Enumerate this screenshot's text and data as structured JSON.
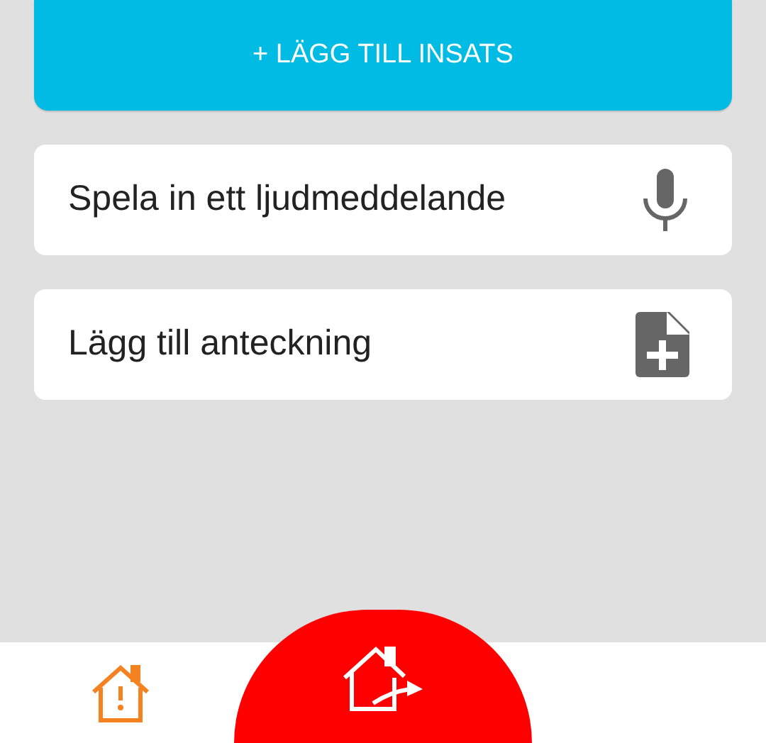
{
  "add_button": {
    "label": "+ LÄGG TILL INSATS"
  },
  "actions": [
    {
      "kind": "audio",
      "label": "Spela in ett ljudmeddelande"
    },
    {
      "kind": "note",
      "label": "Lägg till anteckning"
    }
  ],
  "bottom_nav": [
    {
      "kind": "alert-home",
      "selected": false
    },
    {
      "kind": "leave-home",
      "selected": true
    }
  ]
}
